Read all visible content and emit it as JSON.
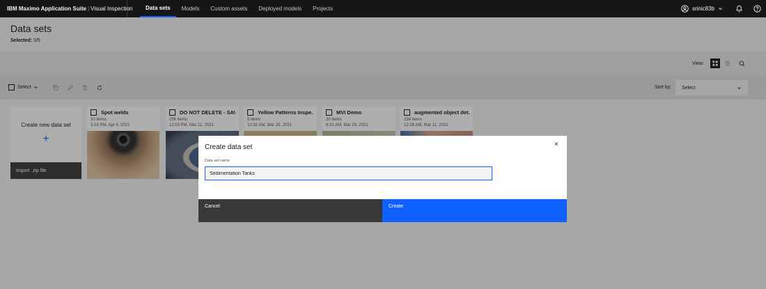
{
  "app": {
    "brand_bold": "IBM Maximo Application Suite",
    "brand_sep": "|",
    "brand_product": "Visual Inspection",
    "colors": {
      "nav_bg": "#161616",
      "accent": "#0f62fe"
    }
  },
  "nav": {
    "tabs": [
      "Data sets",
      "Models",
      "Custom assets",
      "Deployed models",
      "Projects"
    ],
    "active_tab": "Data sets",
    "user": "srinic83b"
  },
  "header": {
    "title": "Data sets",
    "selected_label": "Selected:",
    "selected_value": "0/5"
  },
  "viewbar": {
    "label": "View:"
  },
  "toolbar": {
    "select_label": "Select",
    "sort_label": "Sort by:",
    "sort_value": "Select"
  },
  "create_card": {
    "title": "Create new data set",
    "plus": "+",
    "import_label": "Import .zip file"
  },
  "cards": [
    {
      "title": "Spot welds",
      "count": "10 items",
      "date": "3:18 PM, Apr 9, 2021"
    },
    {
      "title": "DO NOT DELETE - SAV...",
      "count": "256 items",
      "date": "12:03 PM, Mar 11, 2021"
    },
    {
      "title": "Yellow Patterns Inspe...",
      "count": "5 items",
      "date": "10:32 AM, Mar 26, 2021"
    },
    {
      "title": "MVI Demo",
      "count": "20 items",
      "date": "6:31 AM, Mar 29, 2021"
    },
    {
      "title": "augmented object det...",
      "count": "234 items",
      "date": "12:26 AM, Mar 11, 2021"
    }
  ],
  "modal": {
    "title": "Create data set",
    "field_label": "Data set name",
    "field_value": "Sedimentation Tanks",
    "cancel_label": "Cancel",
    "create_label": "Create",
    "close_glyph": "×"
  }
}
